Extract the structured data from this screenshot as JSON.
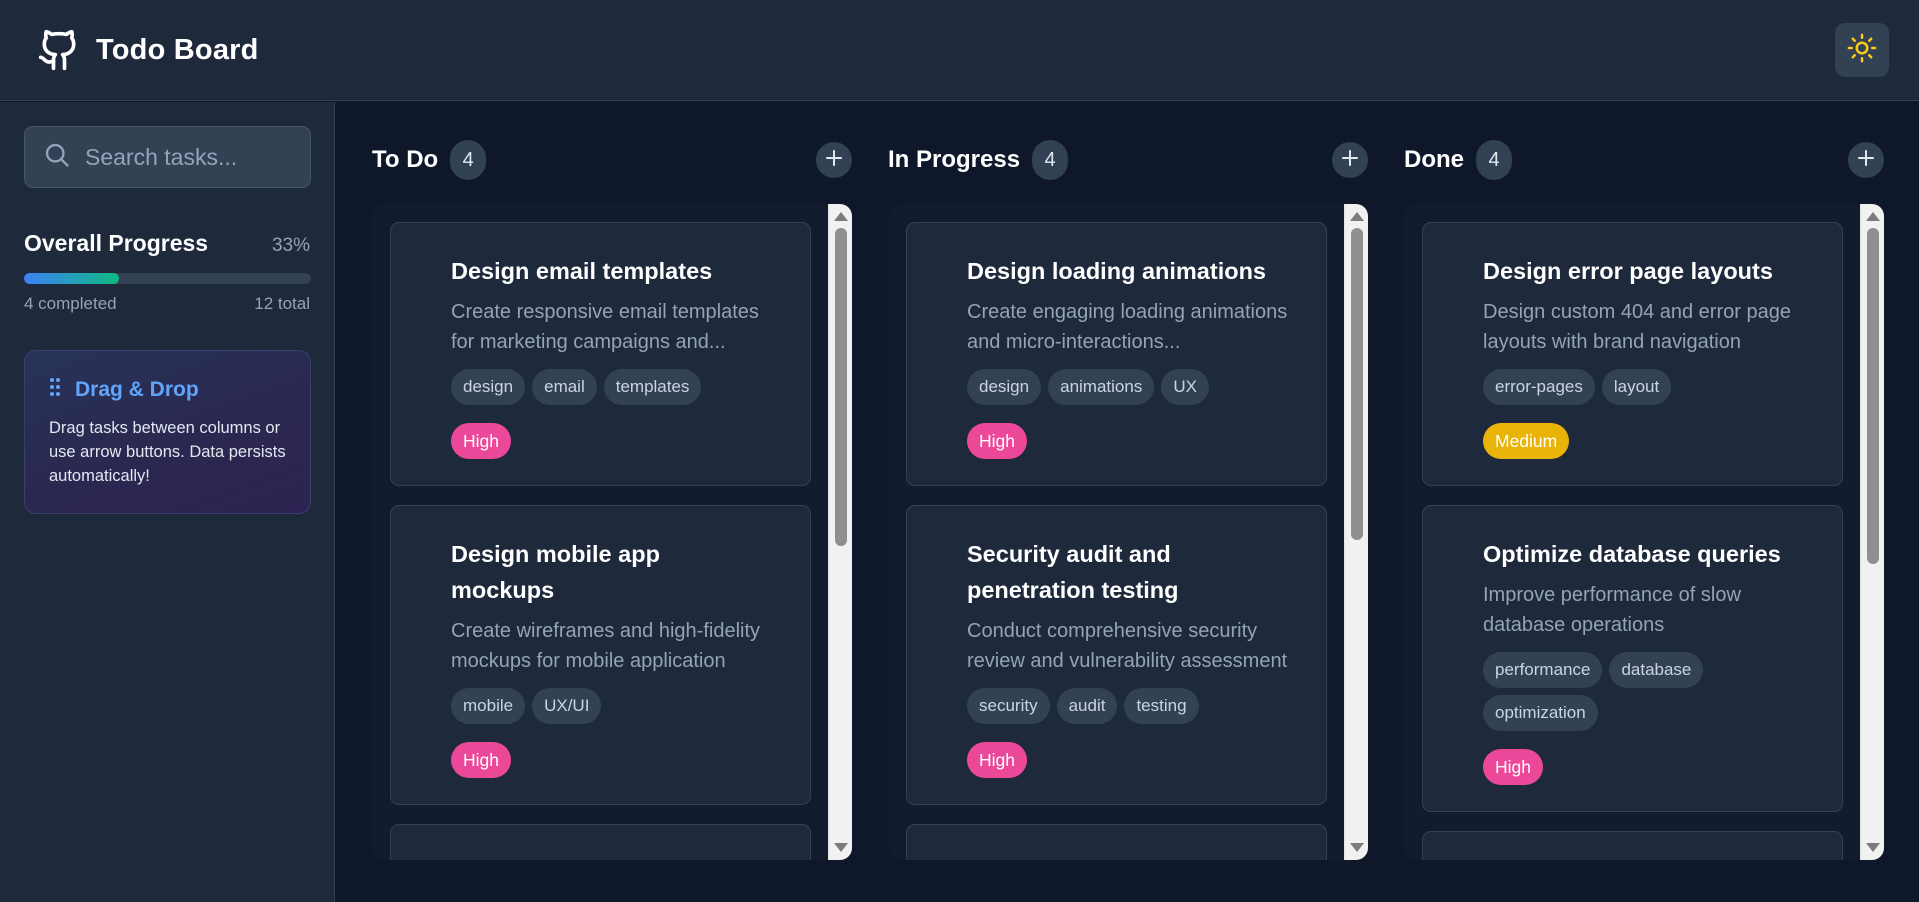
{
  "header": {
    "title": "Todo Board",
    "logo_icon": "github-icon",
    "theme_icon": "sun-icon"
  },
  "sidebar": {
    "search_placeholder": "Search tasks...",
    "progress": {
      "title": "Overall Progress",
      "percent_label": "33%",
      "fraction": 0.33,
      "completed_label": "4 completed",
      "total_label": "12 total"
    },
    "dnd": {
      "title": "Drag & Drop",
      "text": "Drag tasks between columns or use arrow buttons. Data persists automatically!"
    }
  },
  "columns": [
    {
      "title": "To Do",
      "count": "4",
      "cards": [
        {
          "title": "Design email templates",
          "desc": "Create responsive email templates for marketing campaigns and...",
          "tags": [
            "design",
            "email",
            "templates"
          ],
          "priority": "High"
        },
        {
          "title": "Design mobile app mockups",
          "desc": "Create wireframes and high-fidelity mockups for mobile application",
          "tags": [
            "mobile",
            "UX/UI"
          ],
          "priority": "High"
        }
      ]
    },
    {
      "title": "In Progress",
      "count": "4",
      "cards": [
        {
          "title": "Design loading animations",
          "desc": "Create engaging loading animations and micro-interactions...",
          "tags": [
            "design",
            "animations",
            "UX"
          ],
          "priority": "High"
        },
        {
          "title": "Security audit and penetration testing",
          "desc": "Conduct comprehensive security review and vulnerability assessment",
          "tags": [
            "security",
            "audit",
            "testing"
          ],
          "priority": "High"
        }
      ]
    },
    {
      "title": "Done",
      "count": "4",
      "cards": [
        {
          "title": "Design error page layouts",
          "desc": "Design custom 404 and error page layouts with brand navigation",
          "tags": [
            "error-pages",
            "layout"
          ],
          "priority": "Medium"
        },
        {
          "title": "Optimize database queries",
          "desc": "Improve performance of slow database operations",
          "tags": [
            "performance",
            "database",
            "optimization"
          ],
          "priority": "High"
        }
      ]
    }
  ],
  "colors": {
    "high": "#ec4899",
    "medium": "#eab308",
    "accent": "#60a5fa"
  }
}
